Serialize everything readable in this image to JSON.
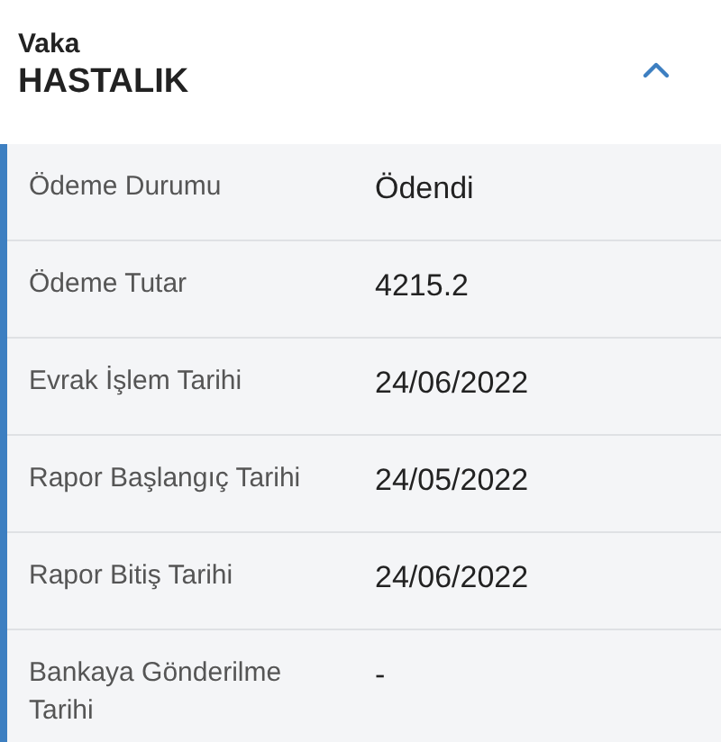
{
  "header": {
    "caption": "Vaka",
    "title": "HASTALIK",
    "expanded": true
  },
  "rows": [
    {
      "label": "Ödeme Durumu",
      "value": "Ödendi"
    },
    {
      "label": "Ödeme Tutar",
      "value": "4215.2"
    },
    {
      "label": "Evrak İşlem Tarihi",
      "value": "24/06/2022"
    },
    {
      "label": "Rapor Başlangıç Tarihi",
      "value": "24/05/2022"
    },
    {
      "label": "Rapor Bitiş Tarihi",
      "value": "24/06/2022"
    },
    {
      "label": "Bankaya Gönderilme Tarihi",
      "value": "-"
    }
  ]
}
